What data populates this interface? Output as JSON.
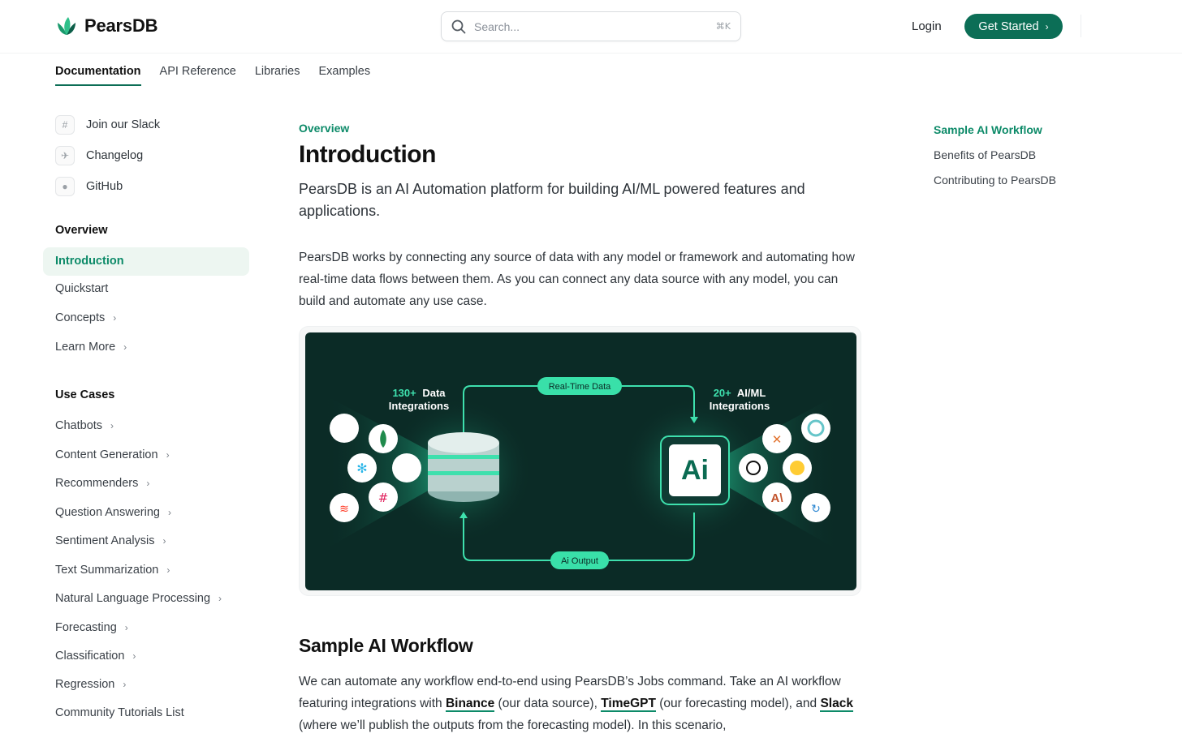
{
  "brand": {
    "name": "PearsDB",
    "logo_icon": "leaf-logo-icon",
    "accent": "#0c6e56",
    "accent_text": "#0c8a68"
  },
  "search": {
    "placeholder": "Search...",
    "shortcut": "⌘K"
  },
  "header": {
    "login": "Login",
    "get_started": "Get Started"
  },
  "tabs": [
    {
      "label": "Documentation",
      "active": true
    },
    {
      "label": "API Reference"
    },
    {
      "label": "Libraries"
    },
    {
      "label": "Examples"
    }
  ],
  "sidebar": {
    "links": [
      {
        "label": "Join our Slack",
        "icon": "slack-icon"
      },
      {
        "label": "Changelog",
        "icon": "rocket-icon"
      },
      {
        "label": "GitHub",
        "icon": "github-icon"
      }
    ],
    "overview_heading": "Overview",
    "overview_items": [
      {
        "label": "Introduction",
        "active": true
      },
      {
        "label": "Quickstart"
      },
      {
        "label": "Concepts",
        "chevron": true
      },
      {
        "label": "Learn More",
        "chevron": true
      }
    ],
    "usecases_heading": "Use Cases",
    "usecase_items": [
      "Chatbots",
      "Content Generation",
      "Recommenders",
      "Question Answering",
      "Sentiment Analysis",
      "Text Summarization",
      "Natural Language Processing",
      "Forecasting",
      "Classification",
      "Regression"
    ],
    "community": "Community Tutorials List"
  },
  "content": {
    "eyebrow": "Overview",
    "title": "Introduction",
    "lead": "PearsDB is an AI Automation platform for building AI/ML powered features and applications.",
    "paragraph": "PearsDB works by connecting any source of data with any model or framework and automating how real-time data flows between them. As you can connect any data source with any model, you can build and automate any use case.",
    "figure": {
      "left_count": "130+",
      "left_label": "Data",
      "left_label2": "Integrations",
      "right_count": "20+",
      "right_label": "AI/ML",
      "right_label2": "Integrations",
      "top_pill": "Real-Time Data",
      "bottom_pill": "Ai Output",
      "chip_text": "Ai"
    },
    "h2": "Sample AI Workflow",
    "para2_a": "We can automate any workflow end-to-end using PearsDB’s Jobs command. Take an AI workflow featuring integrations with ",
    "link1": "Binance",
    "para2_b": " (our data source), ",
    "link2": "TimeGPT",
    "para2_c": " (our forecasting model), and ",
    "link3": "Slack",
    "para2_d": " (where we’ll publish the outputs from the forecasting model). In this scenario,"
  },
  "toc": [
    {
      "label": "Sample AI Workflow",
      "active": true
    },
    {
      "label": "Benefits of PearsDB"
    },
    {
      "label": "Contributing to PearsDB"
    }
  ]
}
